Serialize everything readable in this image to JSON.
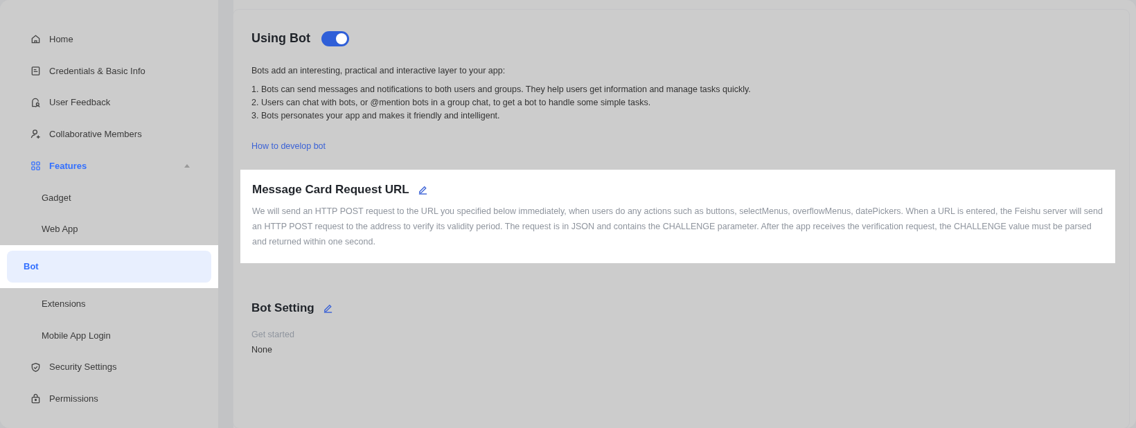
{
  "sidebar": {
    "items": [
      {
        "label": "Home",
        "selected": false,
        "highlighted": false
      },
      {
        "label": "Credentials & Basic Info",
        "selected": false,
        "highlighted": false
      },
      {
        "label": "User Feedback",
        "selected": false,
        "highlighted": false
      },
      {
        "label": "Collaborative Members",
        "selected": false,
        "highlighted": false
      },
      {
        "label": "Features",
        "selected": true,
        "highlighted": false,
        "expanded": true,
        "children": [
          {
            "label": "Gadget",
            "selected": false,
            "highlighted": false
          },
          {
            "label": "Web App",
            "selected": false,
            "highlighted": false
          },
          {
            "label": "Bot",
            "selected": true,
            "highlighted": true
          },
          {
            "label": "Extensions",
            "selected": false,
            "highlighted": false
          },
          {
            "label": "Mobile App Login",
            "selected": false,
            "highlighted": false
          }
        ]
      },
      {
        "label": "Security Settings",
        "selected": false,
        "highlighted": false
      },
      {
        "label": "Permissions",
        "selected": false,
        "highlighted": false
      }
    ]
  },
  "using_bot": {
    "title": "Using Bot",
    "on": true,
    "intro": "Bots add an interesting, practical and interactive layer to your app:",
    "points": [
      "1. Bots can send messages and notifications to both users and groups. They help users get information and manage tasks quickly.",
      "2. Users can chat with bots, or @mention bots in a group chat, to get a bot to handle some simple tasks.",
      "3. Bots personates your app and makes it friendly and intelligent."
    ],
    "link": "How to develop bot"
  },
  "message_card": {
    "title": "Message Card Request URL",
    "highlighted": true,
    "description": "We will send an HTTP POST request to the URL you specified below immediately, when users do any actions such as buttons, selectMenus, overflowMenus, datePickers. When a URL is entered, the Feishu server will send an HTTP POST request to the address to verify its validity period. The request is in JSON and contains the CHALLENGE parameter. After the app receives the verification request, the CHALLENGE value must be parsed and returned within one second."
  },
  "bot_setting": {
    "title": "Bot Setting",
    "fields": [
      {
        "label": "Get started",
        "value": "None"
      }
    ]
  }
}
